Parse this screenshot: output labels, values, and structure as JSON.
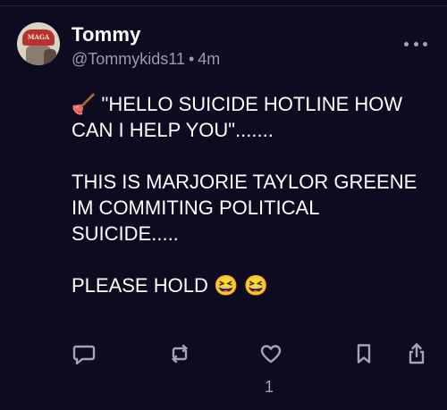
{
  "post": {
    "author": {
      "display_name": "Tommy",
      "handle": "@Tommykids11",
      "avatar_text": "MAGA"
    },
    "separator": "•",
    "time_ago": "4m",
    "text": "🪠 \"HELLO SUICIDE HOTLINE HOW CAN I HELP YOU\".......\n\nTHIS IS MARJORIE TAYLOR GREENE IM COMMITING POLITICAL SUICIDE.....\n\nPLEASE HOLD 😆 😆",
    "actions": {
      "reply_icon": "speech-bubble-icon",
      "repost_icon": "repost-arrows-icon",
      "like_icon": "heart-icon",
      "like_count": "1",
      "bookmark_icon": "bookmark-icon",
      "share_icon": "share-icon"
    }
  },
  "colors": {
    "background": "#0c0b1f",
    "text_primary": "#ffffff",
    "text_secondary": "#9c9aae",
    "icon": "#a5a3b6"
  }
}
